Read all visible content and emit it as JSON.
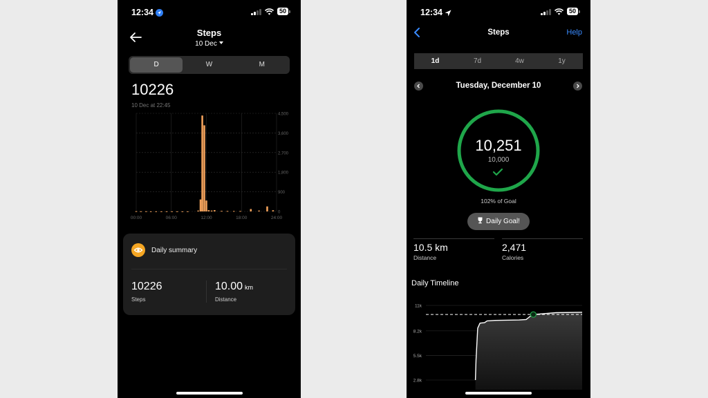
{
  "left": {
    "status": {
      "time": "12:34",
      "battery": "50"
    },
    "title": "Steps",
    "date": "10 Dec",
    "tabs": [
      {
        "label": "D",
        "active": true
      },
      {
        "label": "W",
        "active": false
      },
      {
        "label": "M",
        "active": false
      }
    ],
    "total": "10226",
    "updated": "10 Dec at 22:45",
    "chart_data": {
      "type": "bar",
      "x_ticks": [
        "00:00",
        "06:00",
        "12:00",
        "18:00",
        "24:00"
      ],
      "y_ticks": [
        "0",
        "900",
        "1,800",
        "2,700",
        "3,600",
        "4,500"
      ],
      "ylim": [
        0,
        4500
      ],
      "xlim": [
        0,
        24
      ],
      "bar_color": "#f0a05a",
      "bars": [
        {
          "hour": 0.0,
          "value": 10
        },
        {
          "hour": 0.8,
          "value": 8
        },
        {
          "hour": 1.7,
          "value": 8
        },
        {
          "hour": 2.5,
          "value": 5
        },
        {
          "hour": 3.4,
          "value": 5
        },
        {
          "hour": 4.3,
          "value": 5
        },
        {
          "hour": 5.2,
          "value": 5
        },
        {
          "hour": 6.1,
          "value": 5
        },
        {
          "hour": 7.0,
          "value": 5
        },
        {
          "hour": 7.9,
          "value": 5
        },
        {
          "hour": 8.8,
          "value": 5
        },
        {
          "hour": 10.6,
          "value": 40
        },
        {
          "hour": 11.0,
          "value": 550
        },
        {
          "hour": 11.3,
          "value": 4400
        },
        {
          "hour": 11.65,
          "value": 3950
        },
        {
          "hour": 12.0,
          "value": 500
        },
        {
          "hour": 12.4,
          "value": 60
        },
        {
          "hour": 12.9,
          "value": 40
        },
        {
          "hour": 13.4,
          "value": 60
        },
        {
          "hour": 14.6,
          "value": 25
        },
        {
          "hour": 15.6,
          "value": 20
        },
        {
          "hour": 16.7,
          "value": 20
        },
        {
          "hour": 17.8,
          "value": 20
        },
        {
          "hour": 19.6,
          "value": 110
        },
        {
          "hour": 21.0,
          "value": 40
        },
        {
          "hour": 22.4,
          "value": 230
        },
        {
          "hour": 23.4,
          "value": 55
        }
      ]
    },
    "summary": {
      "title": "Daily summary",
      "steps_value": "10226",
      "steps_label": "Steps",
      "distance_value": "10.00",
      "distance_unit": "km",
      "distance_label": "Distance",
      "badge_color": "#f5a623"
    }
  },
  "right": {
    "status": {
      "time": "12:34",
      "battery": "50"
    },
    "title": "Steps",
    "help": "Help",
    "tabs": [
      {
        "label": "1d",
        "active": true
      },
      {
        "label": "7d",
        "active": false
      },
      {
        "label": "4w",
        "active": false
      },
      {
        "label": "1y",
        "active": false
      }
    ],
    "date": "Tuesday, December 10",
    "ring": {
      "value": "10,251",
      "goal": "10,000",
      "percent": 1.02,
      "color": "#1fa64a"
    },
    "percent_label": "102% of Goal",
    "badge": "Daily Goal!",
    "distance_value": "10.5 km",
    "distance_label": "Distance",
    "calories_value": "2,471",
    "calories_label": "Calories",
    "timeline_title": "Daily Timeline",
    "chart_data": {
      "type": "line",
      "y_ticks": [
        "11k",
        "8.2k",
        "5.5k",
        "2.8k"
      ],
      "y_tick_values": [
        11000,
        8200,
        5500,
        2800
      ],
      "ylim": [
        2800,
        11000
      ],
      "xlim": [
        0,
        24
      ],
      "goal": 10000,
      "series": [
        {
          "values": [
            {
              "x": 7.6,
              "y": 2800
            },
            {
              "x": 7.7,
              "y": 5000
            },
            {
              "x": 7.95,
              "y": 8500
            },
            {
              "x": 8.3,
              "y": 9050
            },
            {
              "x": 9.0,
              "y": 9100
            },
            {
              "x": 9.4,
              "y": 9300
            },
            {
              "x": 10.6,
              "y": 9350
            },
            {
              "x": 14.3,
              "y": 9400
            },
            {
              "x": 15.4,
              "y": 9450
            },
            {
              "x": 16.0,
              "y": 9800
            },
            {
              "x": 16.5,
              "y": 10000
            },
            {
              "x": 18.1,
              "y": 10100
            },
            {
              "x": 20.0,
              "y": 10200
            },
            {
              "x": 24.0,
              "y": 10251
            }
          ]
        }
      ],
      "goal_marker_x": 16.5
    }
  }
}
